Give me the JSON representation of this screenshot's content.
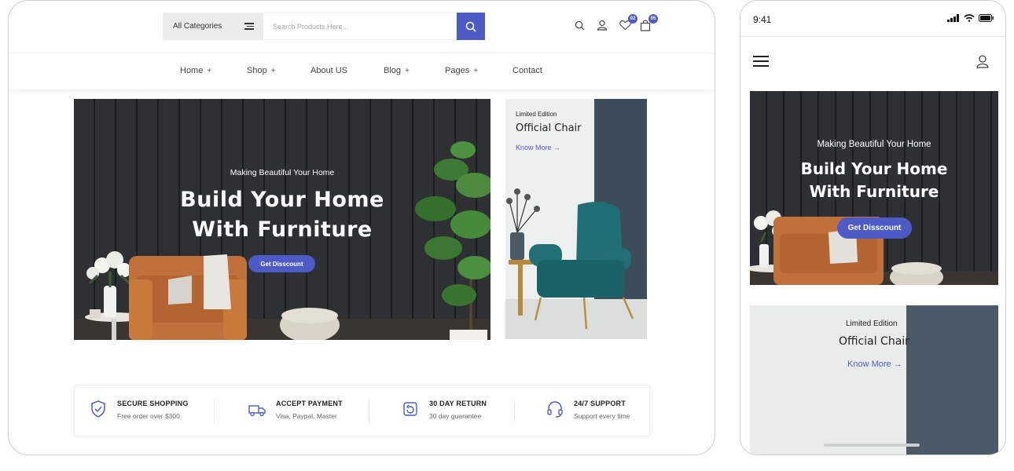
{
  "desktop": {
    "header": {
      "category_label": "All Categories",
      "search_placeholder": "Search Products Here...",
      "wishlist_count": "02",
      "cart_count": "05"
    },
    "nav": [
      {
        "label": "Home",
        "plus": "+"
      },
      {
        "label": "Shop",
        "plus": "+"
      },
      {
        "label": "About US",
        "plus": ""
      },
      {
        "label": "Blog",
        "plus": "+"
      },
      {
        "label": "Pages",
        "plus": "+"
      },
      {
        "label": "Contact",
        "plus": ""
      }
    ],
    "hero": {
      "subtitle": "Making Beautiful Your Home",
      "title_line1": "Build Your Home",
      "title_line2": "With Furniture",
      "button": "Get Disscount"
    },
    "side_banner": {
      "small": "Limited Edition",
      "title": "Official Chair",
      "link": "Know More →"
    },
    "features": [
      {
        "title": "SECURE SHOPPING",
        "sub": "Free order over $300",
        "icon": "shield-check-icon"
      },
      {
        "title": "ACCEPT PAYMENT",
        "sub": "Visa, Paypal, Master",
        "icon": "truck-icon"
      },
      {
        "title": "30 DAY RETURN",
        "sub": "30 day guarantee",
        "icon": "return-box-icon"
      },
      {
        "title": "24/7 SUPPORT",
        "sub": "Support every time",
        "icon": "headset-icon"
      }
    ]
  },
  "mobile": {
    "status_time": "9:41",
    "hero": {
      "subtitle": "Making Beautiful Your Home",
      "title_line1": "Build Your Home",
      "title_line2": "With Furniture",
      "button": "Get Disscount"
    },
    "banner": {
      "small": "Limited Edition",
      "title": "Official Chair",
      "link": "Know More →"
    }
  },
  "colors": {
    "accent": "#4e5bc7",
    "dark_wall": "#2f3033",
    "teal_chair": "#1f6f74",
    "leather": "#c97a3a"
  }
}
